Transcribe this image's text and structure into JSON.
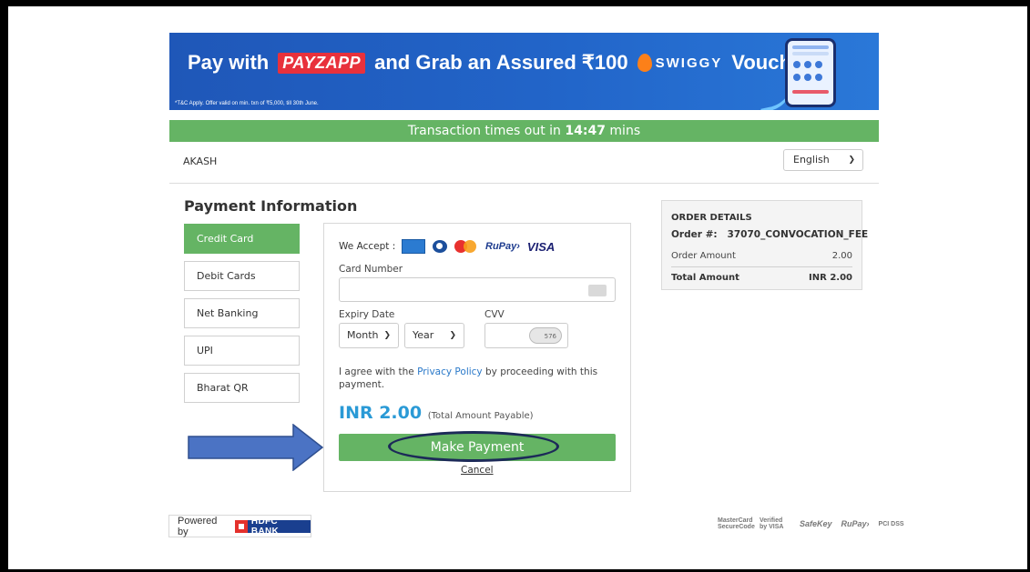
{
  "banner": {
    "pay_with": "Pay with",
    "payzapp": "PAYZAPP",
    "offer_text": "and Grab an Assured ₹100",
    "swiggy": "SWIGGY",
    "voucher": "Voucher*",
    "tnc": "*T&C Apply. Offer valid on min. txn of ₹5,000, till 30th June."
  },
  "timer": {
    "prefix": "Transaction times out in",
    "time": "14:47",
    "suffix": "mins"
  },
  "merchant_name": "AKASH",
  "language": {
    "selected": "English"
  },
  "payment": {
    "heading": "Payment Information",
    "methods": [
      "Credit Card",
      "Debit Cards",
      "Net Banking",
      "UPI",
      "Bharat QR"
    ],
    "active_method": "Credit Card"
  },
  "form": {
    "we_accept": "We Accept :",
    "accepted_cards": [
      "amex-icon",
      "diners-club-icon",
      "mastercard-icon",
      "RuPay›",
      "VISA"
    ],
    "card_number_label": "Card Number",
    "card_number_value": "",
    "expiry_label": "Expiry Date",
    "month": "Month",
    "year": "Year",
    "cvv_label": "CVV",
    "cvv_hint": "576",
    "agree_prefix": "I agree with the",
    "privacy_link": "Privacy Policy",
    "agree_suffix": "by proceeding with this payment.",
    "amount": "INR 2.00",
    "amount_note": "(Total Amount Payable)",
    "pay_button": "Make Payment",
    "cancel": "Cancel"
  },
  "order": {
    "title": "ORDER DETAILS",
    "order_label": "Order #:",
    "order_id": "37070_CONVOCATION_FEE",
    "order_amount_label": "Order Amount",
    "order_amount": "2.00",
    "total_label": "Total Amount",
    "total_value": "INR 2.00"
  },
  "footer": {
    "powered_by": "Powered by",
    "bank": "HDFC BANK",
    "secure_logos": [
      "MasterCard SecureCode",
      "Verified by VISA",
      "SafeKey",
      "RuPay›",
      "PCI DSS"
    ]
  },
  "colors": {
    "banner_blue": "#2265c9",
    "success_green": "#65b464",
    "link_blue": "#2a79c9",
    "amount_blue": "#2a9ad6",
    "annotation_arrow": "#4b73c4",
    "annotation_oval": "#1c2a58"
  }
}
